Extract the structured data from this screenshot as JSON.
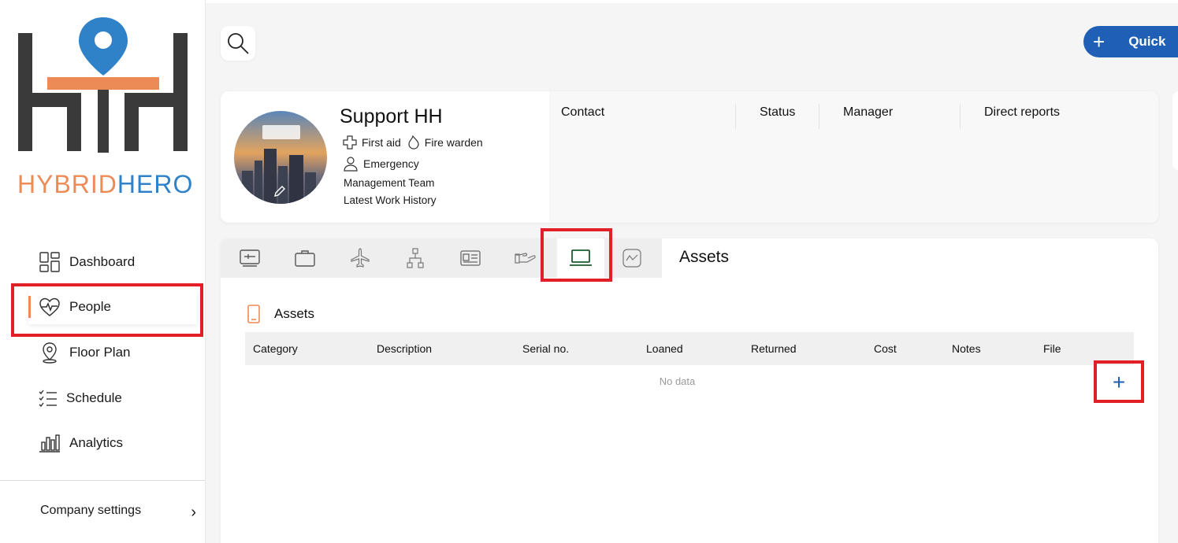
{
  "brand": {
    "logo_text_hybrid": "HYBRID",
    "logo_text_hero": "HERO",
    "accent": "#ec8b56",
    "blue": "#2f82c8"
  },
  "nav": {
    "items": [
      {
        "label": "Dashboard",
        "icon": "dashboard-icon"
      },
      {
        "label": "People",
        "icon": "heart-pulse-icon",
        "active": true
      },
      {
        "label": "Floor Plan",
        "icon": "location-pin-icon"
      },
      {
        "label": "Schedule",
        "icon": "checklist-icon"
      },
      {
        "label": "Analytics",
        "icon": "bar-chart-icon"
      }
    ],
    "company_settings": "Company settings"
  },
  "header": {
    "quick_label": "Quick",
    "primary_color": "#1f5fb5"
  },
  "profile": {
    "name": "Support HH",
    "badges": [
      {
        "label": "First aid",
        "icon": "first-aid-cross-icon"
      },
      {
        "label": "Fire warden",
        "icon": "flame-icon"
      }
    ],
    "emergency": "Emergency",
    "team": "Management Team",
    "history": "Latest Work History",
    "columns": [
      "Contact",
      "Status",
      "Manager",
      "Direct reports"
    ]
  },
  "tabs": {
    "icons": [
      "desk-icon",
      "briefcase-icon",
      "airplane-icon",
      "org-chart-icon",
      "id-card-icon",
      "hand-icon",
      "laptop-icon",
      "chart-icon"
    ],
    "active_index": 6,
    "active_title": "Assets"
  },
  "assets": {
    "section_title": "Assets",
    "columns": [
      "Category",
      "Description",
      "Serial no.",
      "Loaned",
      "Returned",
      "Cost",
      "Notes",
      "File"
    ],
    "empty_text": "No data",
    "add_label": "+"
  }
}
